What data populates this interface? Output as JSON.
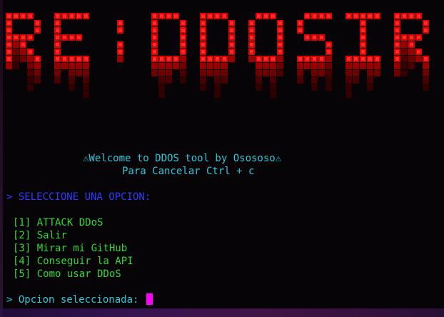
{
  "banner": {
    "text": "RE:DDOSIR"
  },
  "welcome": {
    "line1": "⚠Welcome to DDOS tool by Osososo⚠",
    "line2": "Para Cancelar Ctrl + c"
  },
  "menu": {
    "prompt": "> SELECCIONE UNA OPCION:",
    "items": [
      "[1] ATTACK DDoS",
      "[2] Salir",
      "[3] Mirar mi GitHub",
      "[4] Conseguir la API",
      "[5] Como usar DDoS"
    ]
  },
  "input": {
    "prompt": "> Opcion seleccionada:"
  },
  "colors": {
    "banner": "#e00000",
    "cyan": "#2ec8d8",
    "blue": "#2f3cff",
    "green": "#33d633",
    "cursor": "#ff00ff"
  }
}
